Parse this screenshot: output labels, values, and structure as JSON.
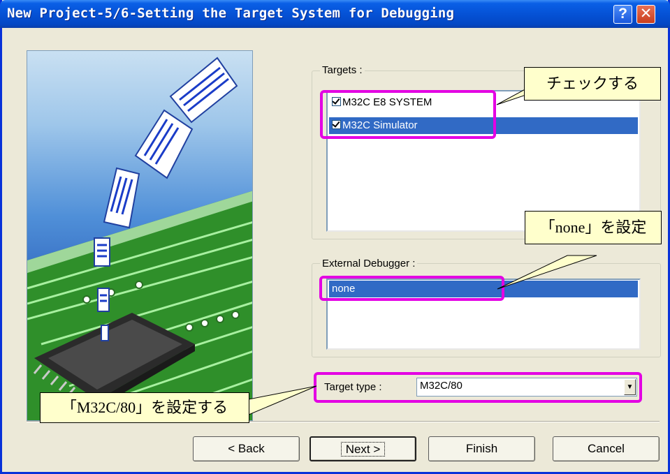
{
  "window": {
    "title": "New Project-5/6-Setting the Target System for Debugging"
  },
  "titlebar_buttons": {
    "help": "?",
    "close": "✕"
  },
  "targets": {
    "label": "Targets :",
    "items": [
      {
        "label": "M32C E8 SYSTEM",
        "checked": true,
        "selected": false
      },
      {
        "label": "M32C Simulator",
        "checked": true,
        "selected": true
      }
    ]
  },
  "external_debugger": {
    "label": "External Debugger :",
    "items": [
      {
        "label": "none",
        "selected": true
      }
    ]
  },
  "target_type": {
    "label": "Target type :",
    "value": "M32C/80"
  },
  "buttons": {
    "back": "< Back",
    "next": "Next >",
    "finish": "Finish",
    "cancel": "Cancel"
  },
  "callouts": {
    "check": "チェックする",
    "none": "「none」を設定",
    "m32c": "「M32C/80」を設定する"
  },
  "colors": {
    "highlight": "#e300e3",
    "selection": "#316ac5",
    "callout_bg": "#ffffcc"
  }
}
